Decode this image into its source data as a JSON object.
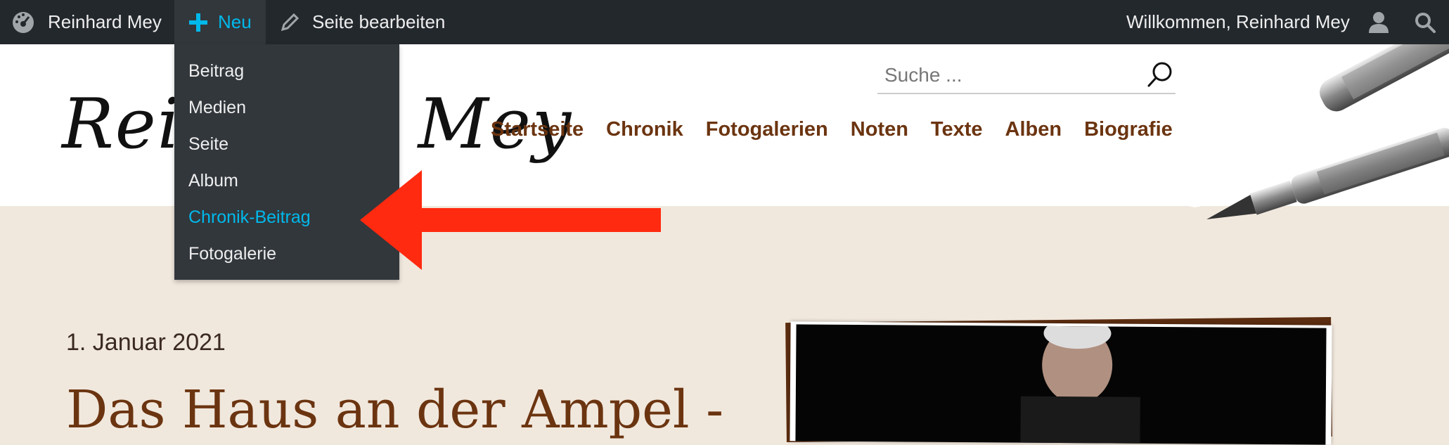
{
  "admin_bar": {
    "site_name": "Reinhard Mey",
    "new_label": "Neu",
    "edit_label": "Seite bearbeiten",
    "welcome": "Willkommen, Reinhard Mey",
    "icons": [
      "dashboard-icon",
      "plus-icon",
      "pencil-icon",
      "user-icon",
      "search-icon"
    ]
  },
  "new_menu": {
    "items": [
      {
        "label": "Beitrag"
      },
      {
        "label": "Medien"
      },
      {
        "label": "Seite"
      },
      {
        "label": "Album"
      },
      {
        "label": "Chronik-Beitrag",
        "highlighted": true
      },
      {
        "label": "Fotogalerie"
      }
    ]
  },
  "header": {
    "logo": "Reinhard Mey",
    "search_placeholder": "Suche ...",
    "nav": [
      {
        "label": "Startseite"
      },
      {
        "label": "Chronik"
      },
      {
        "label": "Fotogalerien"
      },
      {
        "label": "Noten"
      },
      {
        "label": "Texte"
      },
      {
        "label": "Alben"
      },
      {
        "label": "Biografie"
      }
    ]
  },
  "post": {
    "date": "1. Januar 2021",
    "title": "Das Haus an der Ampel -"
  },
  "colors": {
    "admin_bar_bg": "#23282d",
    "menu_bg": "#32373c",
    "accent": "#00b9eb",
    "nav_text": "#6b3410",
    "page_bg": "#f1e8dd",
    "arrow": "#ff2a0f"
  }
}
